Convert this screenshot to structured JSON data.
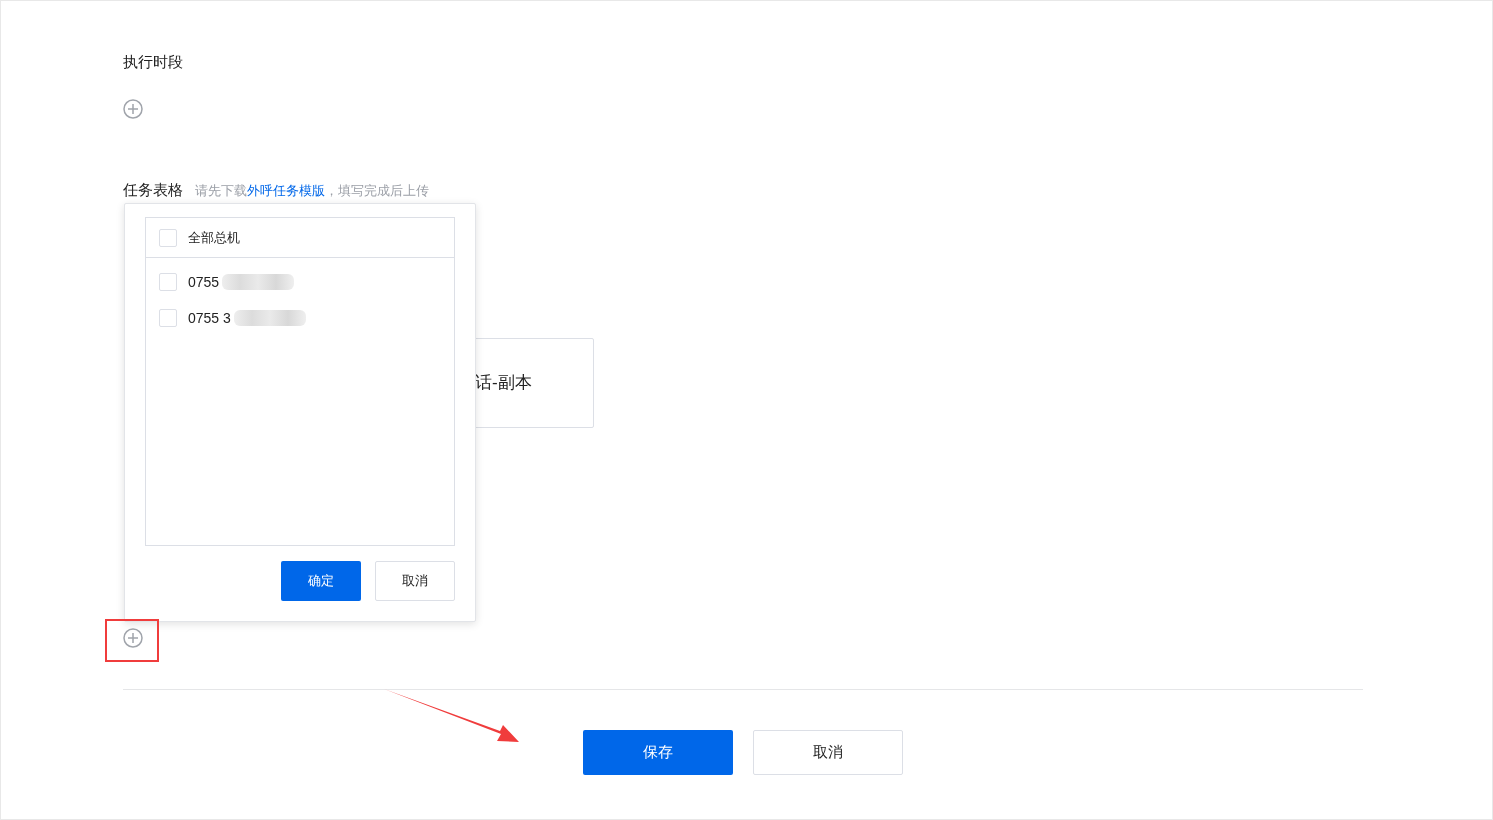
{
  "schedule_section": {
    "title": "执行时段"
  },
  "task_section": {
    "title": "任务表格",
    "hint_before": "请先下载",
    "hint_link": "外呼任务模版",
    "hint_after": "，填写完成后上传",
    "card_label": "话-副本"
  },
  "popup": {
    "select_all": {
      "label": "全部总机",
      "checked": false
    },
    "items": [
      {
        "label": "0755",
        "checked": false
      },
      {
        "label": "0755 3",
        "checked": false
      }
    ],
    "confirm": "确定",
    "cancel": "取消"
  },
  "footer": {
    "save": "保存",
    "cancel": "取消"
  }
}
